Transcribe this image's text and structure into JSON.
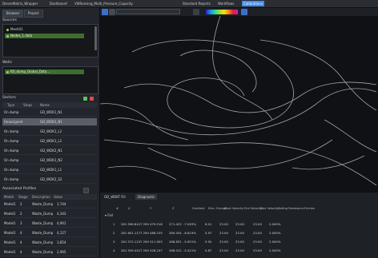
{
  "titlebar": {
    "items": [
      "DenseMatrix_Wrapper",
      "Dashboard",
      "VWSensing_Multi_Pressure_Capacity",
      "Standard Reports",
      "Workflows",
      "Calibrations"
    ]
  },
  "left": {
    "tabs": [
      "Browser",
      "Project"
    ],
    "section1": {
      "label": "Sources",
      "items": [
        "Mesh01",
        "Nodes_1.data"
      ]
    },
    "section2": {
      "label": "Wells",
      "items": [
        "IOI_dump_Global_Data..."
      ]
    },
    "section3": {
      "label": "Sectors",
      "headers": [
        "Type",
        "Steps",
        "Name"
      ],
      "rows": [
        {
          "type": "On dump",
          "name": "GD_WDK1_N1"
        },
        {
          "type": "Unassigned",
          "name": "GD_WDK2_N1"
        },
        {
          "type": "On dump",
          "name": "GD_WDK1_L2"
        },
        {
          "type": "On dump",
          "name": "GD_WDK1_L2"
        },
        {
          "type": "On dump",
          "name": "GD_WDK2_N1"
        },
        {
          "type": "On dump",
          "name": "GD_WDK1_N2"
        },
        {
          "type": "On dump",
          "name": "GD_WDK1_L1"
        },
        {
          "type": "On dump",
          "name": "GD_WDK2_S2"
        }
      ]
    },
    "section4": {
      "label": "Associated Profiles",
      "headers": [
        "Model",
        "Stage",
        "Description",
        "Value"
      ],
      "rows": [
        {
          "model": "Model1",
          "stage": "2",
          "desc": "Waste_Dump",
          "val": "1,744"
        },
        {
          "model": "Model1",
          "stage": "2",
          "desc": "Waste_Dump",
          "val": "4,343"
        },
        {
          "model": "Model1",
          "stage": "3",
          "desc": "Waste_Dump",
          "val": "4,901"
        },
        {
          "model": "Model1",
          "stage": "4",
          "desc": "Waste_Dump",
          "val": "4,127"
        },
        {
          "model": "Model1",
          "stage": "4",
          "desc": "Waste_Dump",
          "val": "3,854"
        },
        {
          "model": "Model1",
          "stage": "4",
          "desc": "Waste_Dump",
          "val": "2,965"
        }
      ]
    }
  },
  "toolbar": {
    "dropdown_value": ""
  },
  "bottom": {
    "tabs": [
      "OD_WDKT Fill",
      "Diagnostic"
    ],
    "headers": [
      "#",
      "X",
      "Y",
      "Z",
      "Gradient",
      "Elev. Change",
      "Start Velocity",
      "End Velocity",
      "Max Velocity",
      "Rolling Resistance",
      "Friction"
    ],
    "group_label": "Fail",
    "rows": [
      {
        "n": "1",
        "x": "281 596.841",
        "y": "7 290 479.516",
        "z": "271.423",
        "grad": "-7.093%",
        "elev": "6.01",
        "sv": "23.00",
        "ev": "23.00",
        "mv": "23.00",
        "rr": "2.000%"
      },
      {
        "n": "2",
        "x": "281 601.117",
        "y": "7 290 488.155",
        "z": "269.434",
        "grad": "-6.619%",
        "elev": "5.97",
        "sv": "23.00",
        "ev": "23.00",
        "mv": "23.00",
        "rr": "2.000%"
      },
      {
        "n": "3",
        "x": "281 572.115",
        "y": "7 290 511.903",
        "z": "268.831",
        "grad": "-5.951%",
        "elev": "5.92",
        "sv": "23.00",
        "ev": "23.00",
        "mv": "23.00",
        "rr": "2.000%"
      },
      {
        "n": "4",
        "x": "281 559.441",
        "y": "7 290 528.247",
        "z": "268.012",
        "grad": "-5.421%",
        "elev": "5.87",
        "sv": "23.00",
        "ev": "23.00",
        "mv": "23.00",
        "rr": "2.000%"
      }
    ]
  },
  "colors": {
    "accent": "#3d8df0",
    "selection_green": "#3e6d2f",
    "canvas_bg": "#101114"
  }
}
